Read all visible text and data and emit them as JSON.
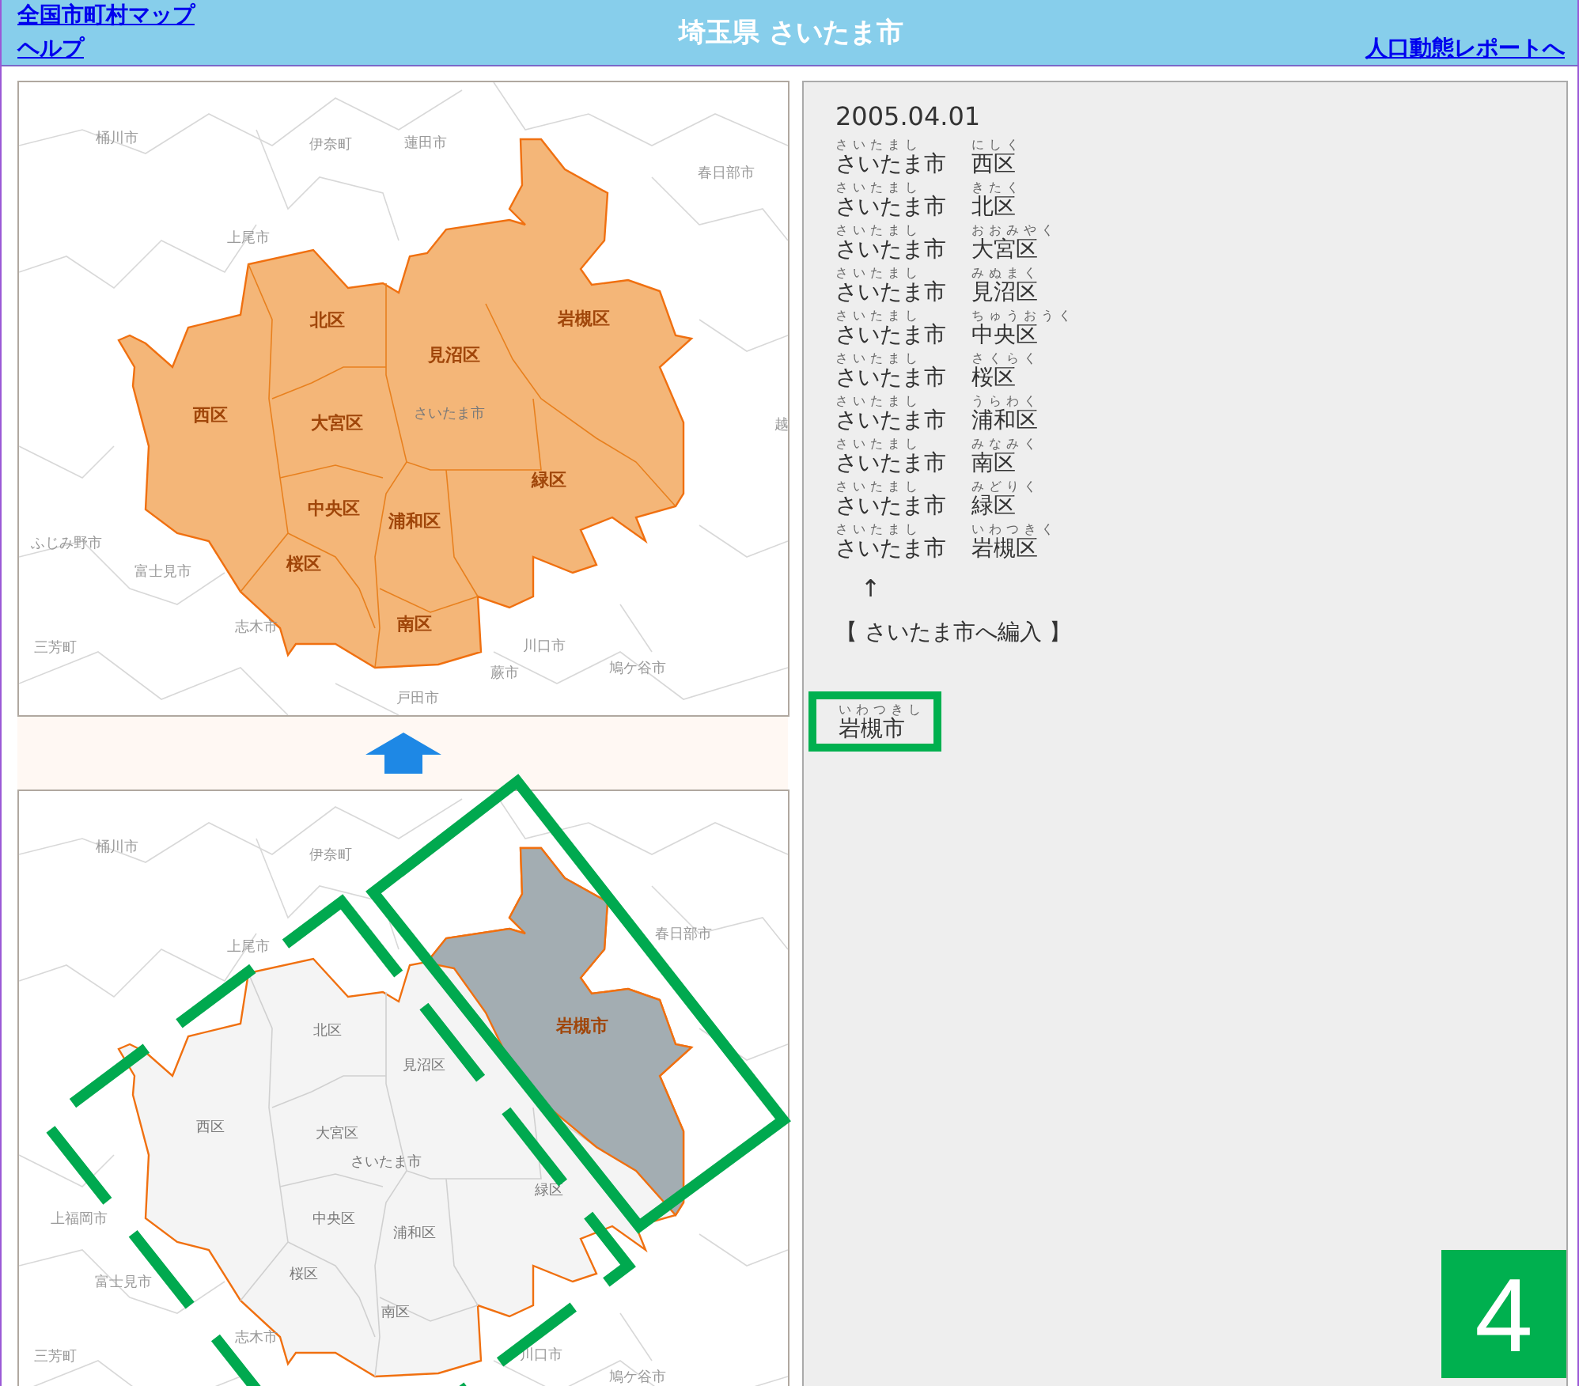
{
  "header": {
    "links_left": [
      "全国市町村マップ",
      "ヘルプ"
    ],
    "title": "埼玉県 さいたま市",
    "link_right": "人口動態レポートへ"
  },
  "maps": [
    {
      "kind": "merged",
      "labels": [
        {
          "text": "桶川市",
          "kind": "neighbor"
        },
        {
          "text": "伊奈町",
          "kind": "neighbor"
        },
        {
          "text": "蓮田市",
          "kind": "neighbor"
        },
        {
          "text": "春日部市",
          "kind": "neighbor"
        },
        {
          "text": "上尾市",
          "kind": "neighbor"
        },
        {
          "text": "北区",
          "kind": "district"
        },
        {
          "text": "見沼区",
          "kind": "district"
        },
        {
          "text": "岩槻区",
          "kind": "district"
        },
        {
          "text": "西区",
          "kind": "district"
        },
        {
          "text": "大宮区",
          "kind": "district"
        },
        {
          "text": "さいたま市",
          "kind": "faint"
        },
        {
          "text": "緑区",
          "kind": "district"
        },
        {
          "text": "中央区",
          "kind": "district"
        },
        {
          "text": "浦和区",
          "kind": "district"
        },
        {
          "text": "桜区",
          "kind": "district"
        },
        {
          "text": "南区",
          "kind": "district"
        },
        {
          "text": "ふじみ野市",
          "kind": "neighbor"
        },
        {
          "text": "富士見市",
          "kind": "neighbor"
        },
        {
          "text": "志木市",
          "kind": "neighbor"
        },
        {
          "text": "三芳町",
          "kind": "neighbor"
        },
        {
          "text": "川口市",
          "kind": "neighbor"
        },
        {
          "text": "鳩ケ谷市",
          "kind": "neighbor"
        },
        {
          "text": "蕨市",
          "kind": "neighbor"
        },
        {
          "text": "戸田市",
          "kind": "neighbor"
        },
        {
          "text": "越",
          "kind": "neighbor"
        }
      ]
    },
    {
      "kind": "before",
      "labels": [
        {
          "text": "桶川市",
          "kind": "neighbor"
        },
        {
          "text": "伊奈町",
          "kind": "neighbor"
        },
        {
          "text": "春日部市",
          "kind": "neighbor"
        },
        {
          "text": "上尾市",
          "kind": "neighbor"
        },
        {
          "text": "北区",
          "kind": "faint"
        },
        {
          "text": "見沼区",
          "kind": "faint"
        },
        {
          "text": "岩槻市",
          "kind": "district"
        },
        {
          "text": "西区",
          "kind": "faint"
        },
        {
          "text": "大宮区",
          "kind": "faint"
        },
        {
          "text": "さいたま市",
          "kind": "faint"
        },
        {
          "text": "緑区",
          "kind": "faint"
        },
        {
          "text": "中央区",
          "kind": "faint"
        },
        {
          "text": "浦和区",
          "kind": "faint"
        },
        {
          "text": "上福岡市",
          "kind": "neighbor"
        },
        {
          "text": "富士見市",
          "kind": "neighbor"
        },
        {
          "text": "桜区",
          "kind": "faint"
        },
        {
          "text": "南区",
          "kind": "faint"
        },
        {
          "text": "志木市",
          "kind": "neighbor"
        },
        {
          "text": "三芳町",
          "kind": "neighbor"
        },
        {
          "text": "川口市",
          "kind": "neighbor"
        },
        {
          "text": "鳩ケ谷市",
          "kind": "neighbor"
        }
      ]
    }
  ],
  "record": {
    "date": "2005.04.01",
    "entries": [
      {
        "city": "さいたま市",
        "city_ruby": "さいたまし",
        "ward": "西区",
        "ward_ruby": "にしく"
      },
      {
        "city": "さいたま市",
        "city_ruby": "さいたまし",
        "ward": "北区",
        "ward_ruby": "きたく"
      },
      {
        "city": "さいたま市",
        "city_ruby": "さいたまし",
        "ward": "大宮区",
        "ward_ruby": "おおみやく"
      },
      {
        "city": "さいたま市",
        "city_ruby": "さいたまし",
        "ward": "見沼区",
        "ward_ruby": "みぬまく"
      },
      {
        "city": "さいたま市",
        "city_ruby": "さいたまし",
        "ward": "中央区",
        "ward_ruby": "ちゅうおうく"
      },
      {
        "city": "さいたま市",
        "city_ruby": "さいたまし",
        "ward": "桜区",
        "ward_ruby": "さくらく"
      },
      {
        "city": "さいたま市",
        "city_ruby": "さいたまし",
        "ward": "浦和区",
        "ward_ruby": "うらわく"
      },
      {
        "city": "さいたま市",
        "city_ruby": "さいたまし",
        "ward": "南区",
        "ward_ruby": "みなみく"
      },
      {
        "city": "さいたま市",
        "city_ruby": "さいたまし",
        "ward": "緑区",
        "ward_ruby": "みどりく"
      },
      {
        "city": "さいたま市",
        "city_ruby": "さいたまし",
        "ward": "岩槻区",
        "ward_ruby": "いわつきく"
      }
    ],
    "arrow": "↑",
    "note": "【 さいたま市へ編入 】",
    "source": {
      "name": "岩槻市",
      "ruby": "いわつきし",
      "highlighted": true
    }
  },
  "step_badge": "4"
}
